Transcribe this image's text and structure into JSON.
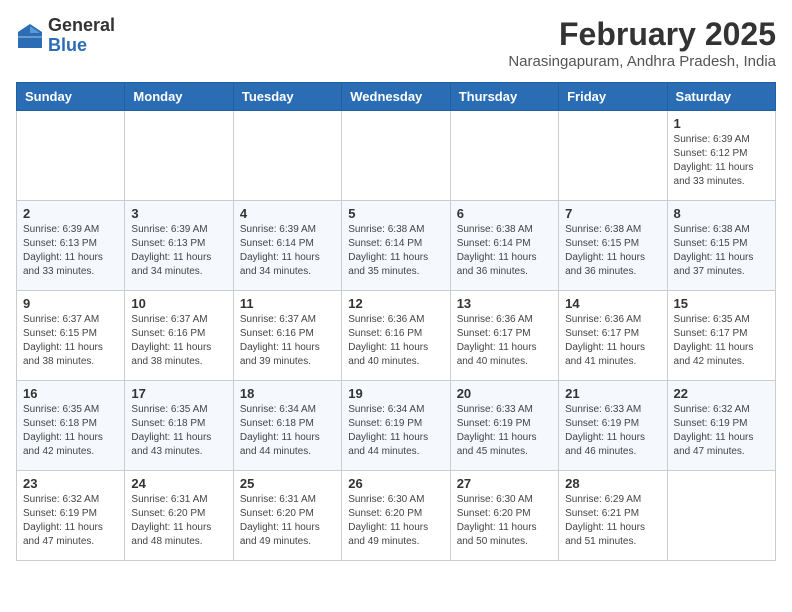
{
  "header": {
    "logo": {
      "line1": "General",
      "line2": "Blue"
    },
    "title": "February 2025",
    "subtitle": "Narasingapuram, Andhra Pradesh, India"
  },
  "days_of_week": [
    "Sunday",
    "Monday",
    "Tuesday",
    "Wednesday",
    "Thursday",
    "Friday",
    "Saturday"
  ],
  "weeks": [
    [
      null,
      null,
      null,
      null,
      null,
      null,
      {
        "day": "1",
        "sunrise": "Sunrise: 6:39 AM",
        "sunset": "Sunset: 6:12 PM",
        "daylight": "Daylight: 11 hours and 33 minutes."
      }
    ],
    [
      {
        "day": "2",
        "sunrise": "Sunrise: 6:39 AM",
        "sunset": "Sunset: 6:13 PM",
        "daylight": "Daylight: 11 hours and 33 minutes."
      },
      {
        "day": "3",
        "sunrise": "Sunrise: 6:39 AM",
        "sunset": "Sunset: 6:13 PM",
        "daylight": "Daylight: 11 hours and 34 minutes."
      },
      {
        "day": "4",
        "sunrise": "Sunrise: 6:39 AM",
        "sunset": "Sunset: 6:14 PM",
        "daylight": "Daylight: 11 hours and 34 minutes."
      },
      {
        "day": "5",
        "sunrise": "Sunrise: 6:38 AM",
        "sunset": "Sunset: 6:14 PM",
        "daylight": "Daylight: 11 hours and 35 minutes."
      },
      {
        "day": "6",
        "sunrise": "Sunrise: 6:38 AM",
        "sunset": "Sunset: 6:14 PM",
        "daylight": "Daylight: 11 hours and 36 minutes."
      },
      {
        "day": "7",
        "sunrise": "Sunrise: 6:38 AM",
        "sunset": "Sunset: 6:15 PM",
        "daylight": "Daylight: 11 hours and 36 minutes."
      },
      {
        "day": "8",
        "sunrise": "Sunrise: 6:38 AM",
        "sunset": "Sunset: 6:15 PM",
        "daylight": "Daylight: 11 hours and 37 minutes."
      }
    ],
    [
      {
        "day": "9",
        "sunrise": "Sunrise: 6:37 AM",
        "sunset": "Sunset: 6:15 PM",
        "daylight": "Daylight: 11 hours and 38 minutes."
      },
      {
        "day": "10",
        "sunrise": "Sunrise: 6:37 AM",
        "sunset": "Sunset: 6:16 PM",
        "daylight": "Daylight: 11 hours and 38 minutes."
      },
      {
        "day": "11",
        "sunrise": "Sunrise: 6:37 AM",
        "sunset": "Sunset: 6:16 PM",
        "daylight": "Daylight: 11 hours and 39 minutes."
      },
      {
        "day": "12",
        "sunrise": "Sunrise: 6:36 AM",
        "sunset": "Sunset: 6:16 PM",
        "daylight": "Daylight: 11 hours and 40 minutes."
      },
      {
        "day": "13",
        "sunrise": "Sunrise: 6:36 AM",
        "sunset": "Sunset: 6:17 PM",
        "daylight": "Daylight: 11 hours and 40 minutes."
      },
      {
        "day": "14",
        "sunrise": "Sunrise: 6:36 AM",
        "sunset": "Sunset: 6:17 PM",
        "daylight": "Daylight: 11 hours and 41 minutes."
      },
      {
        "day": "15",
        "sunrise": "Sunrise: 6:35 AM",
        "sunset": "Sunset: 6:17 PM",
        "daylight": "Daylight: 11 hours and 42 minutes."
      }
    ],
    [
      {
        "day": "16",
        "sunrise": "Sunrise: 6:35 AM",
        "sunset": "Sunset: 6:18 PM",
        "daylight": "Daylight: 11 hours and 42 minutes."
      },
      {
        "day": "17",
        "sunrise": "Sunrise: 6:35 AM",
        "sunset": "Sunset: 6:18 PM",
        "daylight": "Daylight: 11 hours and 43 minutes."
      },
      {
        "day": "18",
        "sunrise": "Sunrise: 6:34 AM",
        "sunset": "Sunset: 6:18 PM",
        "daylight": "Daylight: 11 hours and 44 minutes."
      },
      {
        "day": "19",
        "sunrise": "Sunrise: 6:34 AM",
        "sunset": "Sunset: 6:19 PM",
        "daylight": "Daylight: 11 hours and 44 minutes."
      },
      {
        "day": "20",
        "sunrise": "Sunrise: 6:33 AM",
        "sunset": "Sunset: 6:19 PM",
        "daylight": "Daylight: 11 hours and 45 minutes."
      },
      {
        "day": "21",
        "sunrise": "Sunrise: 6:33 AM",
        "sunset": "Sunset: 6:19 PM",
        "daylight": "Daylight: 11 hours and 46 minutes."
      },
      {
        "day": "22",
        "sunrise": "Sunrise: 6:32 AM",
        "sunset": "Sunset: 6:19 PM",
        "daylight": "Daylight: 11 hours and 47 minutes."
      }
    ],
    [
      {
        "day": "23",
        "sunrise": "Sunrise: 6:32 AM",
        "sunset": "Sunset: 6:19 PM",
        "daylight": "Daylight: 11 hours and 47 minutes."
      },
      {
        "day": "24",
        "sunrise": "Sunrise: 6:31 AM",
        "sunset": "Sunset: 6:20 PM",
        "daylight": "Daylight: 11 hours and 48 minutes."
      },
      {
        "day": "25",
        "sunrise": "Sunrise: 6:31 AM",
        "sunset": "Sunset: 6:20 PM",
        "daylight": "Daylight: 11 hours and 49 minutes."
      },
      {
        "day": "26",
        "sunrise": "Sunrise: 6:30 AM",
        "sunset": "Sunset: 6:20 PM",
        "daylight": "Daylight: 11 hours and 49 minutes."
      },
      {
        "day": "27",
        "sunrise": "Sunrise: 6:30 AM",
        "sunset": "Sunset: 6:20 PM",
        "daylight": "Daylight: 11 hours and 50 minutes."
      },
      {
        "day": "28",
        "sunrise": "Sunrise: 6:29 AM",
        "sunset": "Sunset: 6:21 PM",
        "daylight": "Daylight: 11 hours and 51 minutes."
      },
      null
    ]
  ]
}
